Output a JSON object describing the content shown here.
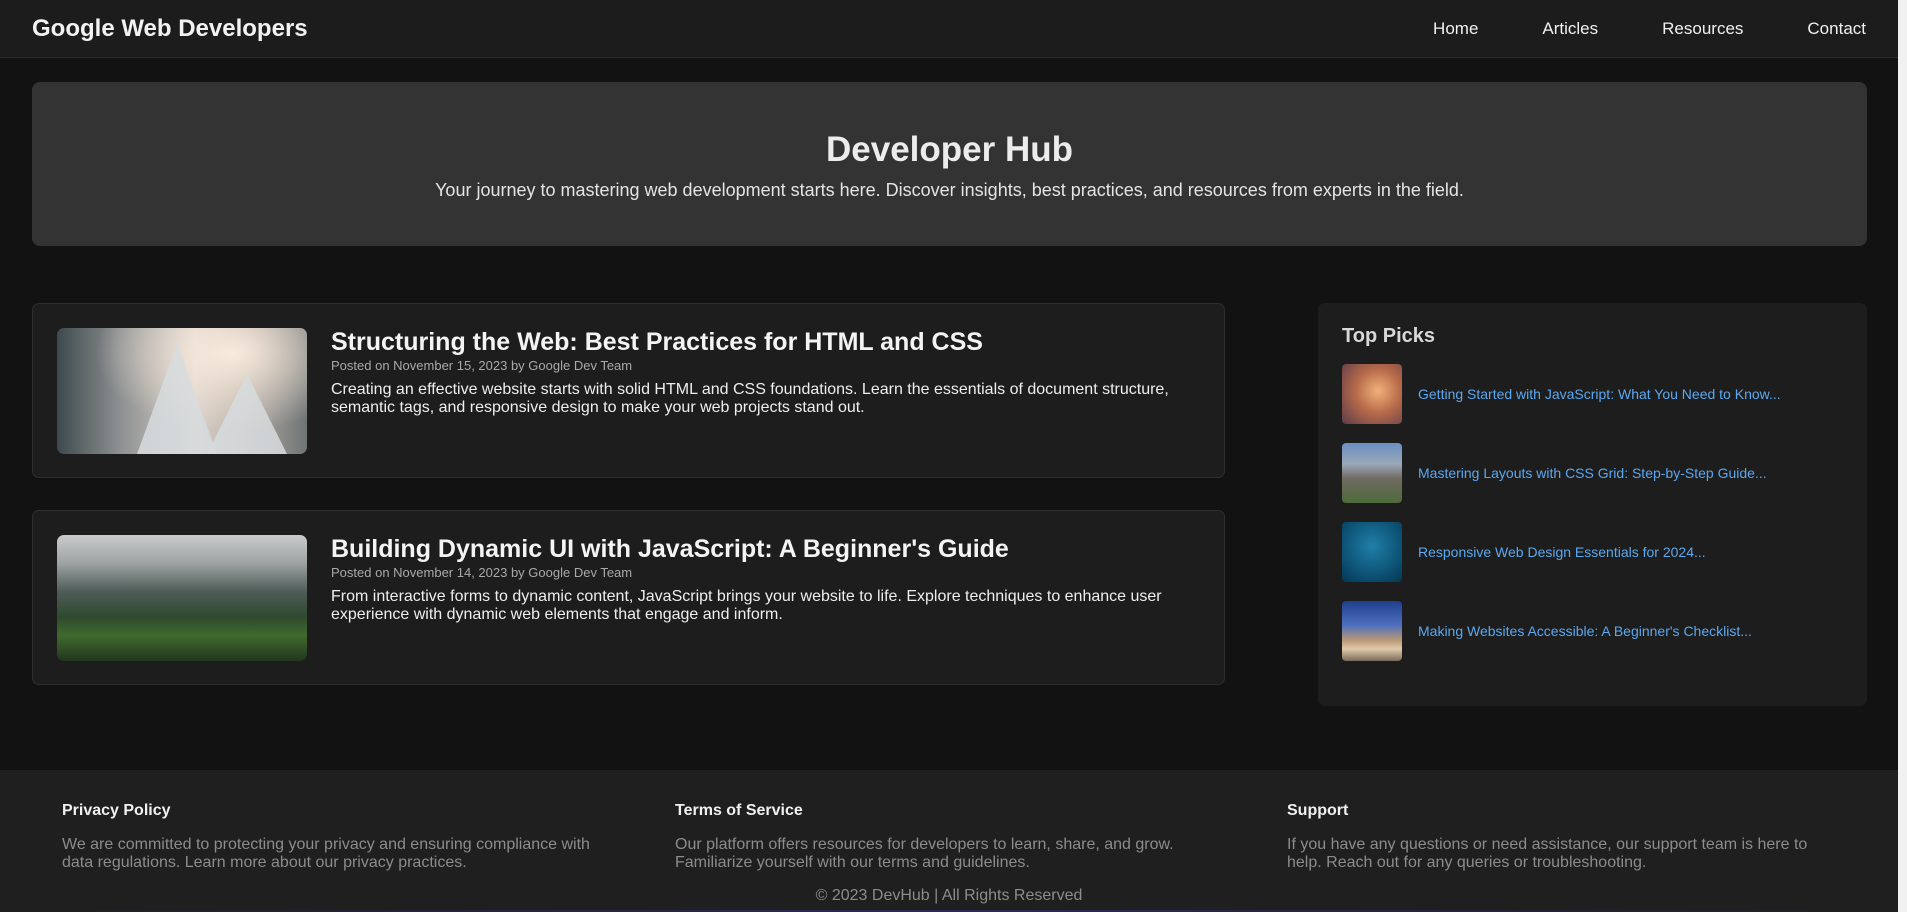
{
  "header": {
    "brand": "Google Web Developers",
    "nav": [
      "Home",
      "Articles",
      "Resources",
      "Contact"
    ]
  },
  "hero": {
    "title": "Developer Hub",
    "subtitle": "Your journey to mastering web development starts here. Discover insights, best practices, and resources from experts in the field."
  },
  "articles": [
    {
      "title": "Structuring the Web: Best Practices for HTML and CSS",
      "meta": "Posted on November 15, 2023 by Google Dev Team",
      "text": "Creating an effective website starts with solid HTML and CSS foundations. Learn the essentials of document structure, semantic tags, and responsive design to make your web projects stand out."
    },
    {
      "title": "Building Dynamic UI with JavaScript: A Beginner's Guide",
      "meta": "Posted on November 14, 2023 by Google Dev Team",
      "text": "From interactive forms to dynamic content, JavaScript brings your website to life. Explore techniques to enhance user experience with dynamic web elements that engage and inform."
    }
  ],
  "sidebar": {
    "title": "Top Picks",
    "items": [
      "Getting Started with JavaScript: What You Need to Know...",
      "Mastering Layouts with CSS Grid: Step-by-Step Guide...",
      "Responsive Web Design Essentials for 2024...",
      "Making Websites Accessible: A Beginner's Checklist..."
    ]
  },
  "footer": {
    "columns": [
      {
        "title": "Privacy Policy",
        "text": "We are committed to protecting your privacy and ensuring compliance with data regulations. Learn more about our privacy practices."
      },
      {
        "title": "Terms of Service",
        "text": "Our platform offers resources for developers to learn, share, and grow. Familiarize yourself with our terms and guidelines."
      },
      {
        "title": "Support",
        "text": "If you have any questions or need assistance, our support team is here to help. Reach out for any queries or troubleshooting."
      }
    ],
    "copyright": "© 2023 DevHub | All Rights Reserved"
  },
  "colors": {
    "background": "#121212",
    "panel": "#1d1d1d",
    "hero": "#333333",
    "link": "#5aa8f0"
  }
}
